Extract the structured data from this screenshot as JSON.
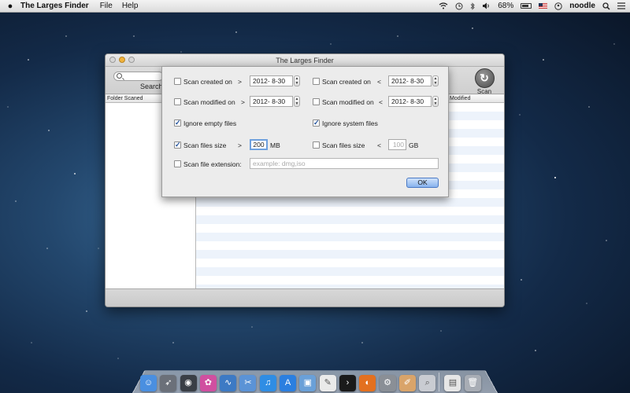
{
  "menubar": {
    "app_name": "The Larges Finder",
    "menu_items": [
      "File",
      "Help"
    ],
    "battery": "68%",
    "user": "noodle"
  },
  "window": {
    "title": "The Larges Finder",
    "search_label": "Search",
    "scan_label": "Scan",
    "left_column_header": "Folder Scaned",
    "modified_column_header": "Modified"
  },
  "sheet": {
    "created_after": {
      "label": "Scan created on",
      "op": ">",
      "date": "2012-  8-30",
      "checked": false
    },
    "created_before": {
      "label": "Scan created on",
      "op": "<",
      "date": "2012-  8-30",
      "checked": false
    },
    "modified_after": {
      "label": "Scan modified on",
      "op": ">",
      "date": "2012-  8-30",
      "checked": false
    },
    "modified_before": {
      "label": "Scan modified on",
      "op": "<",
      "date": "2012-  8-30",
      "checked": false
    },
    "ignore_empty": {
      "label": "Ignore empty files",
      "checked": true
    },
    "ignore_system": {
      "label": "Ignore system files",
      "checked": true
    },
    "size_min": {
      "label": "Scan files size",
      "op": ">",
      "value": "200",
      "unit": "MB",
      "checked": true
    },
    "size_max": {
      "label": "Scan files size",
      "op": "<",
      "value": "100",
      "unit": "GB",
      "checked": false
    },
    "extension": {
      "label": "Scan file extension:",
      "placeholder": "example: dmg,iso",
      "checked": false
    },
    "ok_label": "OK"
  },
  "dock": {
    "icons": [
      {
        "name": "finder-icon",
        "color": "#4a8fe0",
        "glyph": "☺"
      },
      {
        "name": "launchpad-icon",
        "color": "#6b7079",
        "glyph": "➶"
      },
      {
        "name": "dashboard-icon",
        "color": "#3a3f46",
        "glyph": "◉"
      },
      {
        "name": "photo-booth-icon",
        "color": "#d04fa0",
        "glyph": "✿"
      },
      {
        "name": "activity-monitor-icon",
        "color": "#3d7ac4",
        "glyph": "∿"
      },
      {
        "name": "utilities-folder-icon",
        "color": "#5b93d6",
        "glyph": "✂"
      },
      {
        "name": "itunes-icon",
        "color": "#2f8de4",
        "glyph": "♫"
      },
      {
        "name": "app-store-icon",
        "color": "#2b7fe0",
        "glyph": "A"
      },
      {
        "name": "preview-icon",
        "color": "#6aa0d8",
        "glyph": "▣"
      },
      {
        "name": "textedit-icon",
        "color": "#eaeaea",
        "glyph": "✎"
      },
      {
        "name": "terminal-icon",
        "color": "#1a1a1a",
        "glyph": "›"
      },
      {
        "name": "firefox-icon",
        "color": "#e3701f",
        "glyph": "◐"
      },
      {
        "name": "system-preferences-icon",
        "color": "#8a8f96",
        "glyph": "⚙"
      },
      {
        "name": "script-editor-icon",
        "color": "#d9a46a",
        "glyph": "✐"
      },
      {
        "name": "spotlight-magnifier-icon",
        "color": "#c9ccd2",
        "glyph": "⌕"
      },
      {
        "name": "downloads-stack-icon",
        "color": "#e6e6e6",
        "glyph": "▤"
      },
      {
        "name": "trash-icon",
        "color": "#a8adb5",
        "glyph": "🗑"
      }
    ]
  }
}
